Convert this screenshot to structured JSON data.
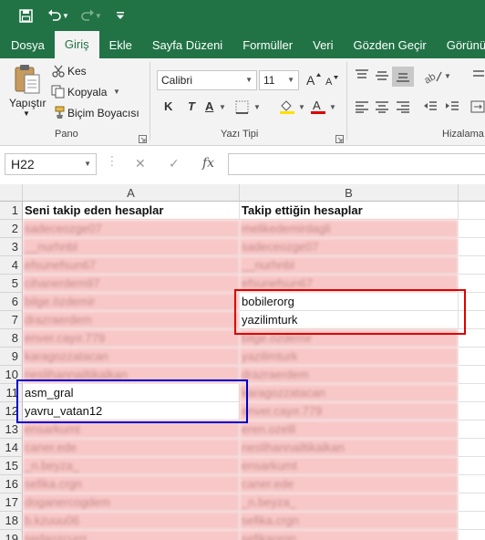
{
  "tabs": [
    "Dosya",
    "Giriş",
    "Ekle",
    "Sayfa Düzeni",
    "Formüller",
    "Veri",
    "Gözden Geçir",
    "Görünüm"
  ],
  "ribbon": {
    "paste_label": "Yapıştır",
    "cut_label": "Kes",
    "copy_label": "Kopyala",
    "format_painter_label": "Biçim Boyacısı",
    "clipboard_group": "Pano",
    "font_name": "Calibri",
    "font_size": "11",
    "font_group": "Yazı Tipi",
    "bold_label": "K",
    "italic_label": "T",
    "underline_label": "A",
    "alignment_group": "Hizalama"
  },
  "formula_bar": {
    "name_box": "H22",
    "fx_label": "fx",
    "value": ""
  },
  "sheet": {
    "columns": [
      "A",
      "B"
    ],
    "row_numbers": [
      "1",
      "2",
      "3",
      "4",
      "5",
      "6",
      "7",
      "8",
      "9",
      "10",
      "11",
      "12",
      "13",
      "14",
      "15",
      "16",
      "17",
      "18",
      "19"
    ],
    "header_a": "Seni takip eden hesaplar",
    "header_b": "Takip ettiğin hesaplar",
    "col_a_blurred": [
      "sadeceozge07",
      "__nurhnbl",
      "efsunefsun67",
      "cihanerdem97",
      "bilge.özdemir",
      "drazraerdem",
      "enver.cayır.779",
      "karagozzatacan",
      "neslihannailtikalkan"
    ],
    "col_a_visible": [
      "asm_gral",
      "yavru_vatan12"
    ],
    "col_a_blurred_2": [
      "ensarkumt",
      "caner.ede",
      "_n.beyza_",
      "sefika.crgn",
      "doganercogdem",
      "b.kzuuu06",
      "sedaozcurrr"
    ],
    "col_b_blurred": [
      "melikedemirdagli",
      "sadeceozge07",
      "__nurhnbl",
      "efsunefsun67"
    ],
    "col_b_visible": [
      "bobilerorg",
      "yazilimturk"
    ],
    "col_b_blurred_2": [
      "bilge.özdemir",
      "yazilimturk",
      "drazraerdem",
      "karagozzatacan",
      "enver.cayır.779",
      "eren.ozelll",
      "neslihannailtikalkan",
      "ensarkumt",
      "caner.ede",
      "_n.beyza_",
      "sefika.crgn",
      "sefikaorgn"
    ]
  },
  "colors": {
    "excel_green": "#217346",
    "pink_fill": "#f8c7c7",
    "red_highlight": "#e00000",
    "blue_highlight": "#0000cc"
  }
}
